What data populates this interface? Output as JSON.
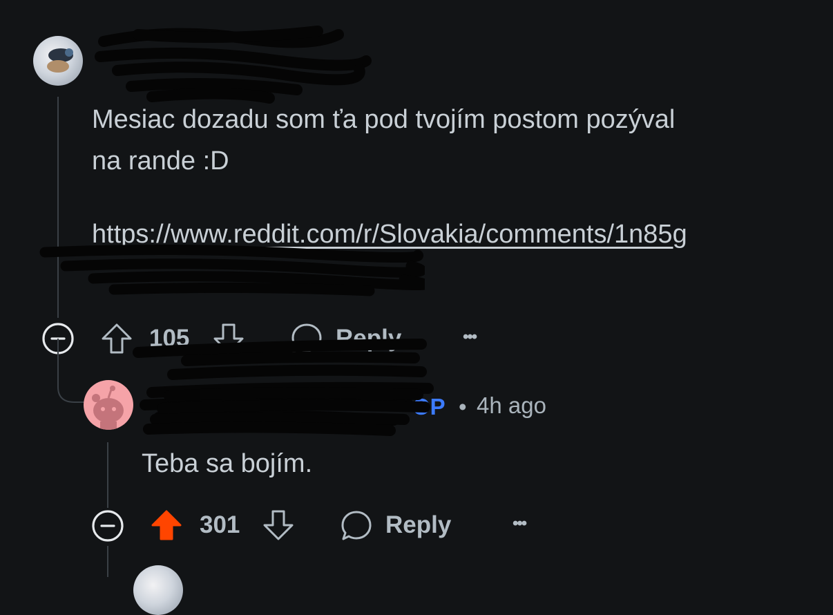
{
  "comment1": {
    "username": "",
    "body_line1": "Mesiac dozadu som ťa pod tvojím postom pozýval",
    "body_line2": "na rande :D",
    "link_line1": "https://www.reddit.com/r/Slovakia/comments/1n85g",
    "upvotes": "105",
    "reply_label": "Reply",
    "more_label": "•••"
  },
  "comment2": {
    "username": "",
    "op_badge": "OP",
    "separator": "•",
    "time": "4h ago",
    "body": "Teba sa bojím.",
    "upvotes": "301",
    "reply_label": "Reply",
    "more_label": "•••",
    "upvote_active_color": "#ff4500"
  },
  "icons": {
    "collapse": "minus-circle-icon",
    "upvote": "arrow-up-icon",
    "downvote": "arrow-down-icon",
    "reply": "speech-bubble-icon",
    "more": "ellipsis-icon"
  }
}
